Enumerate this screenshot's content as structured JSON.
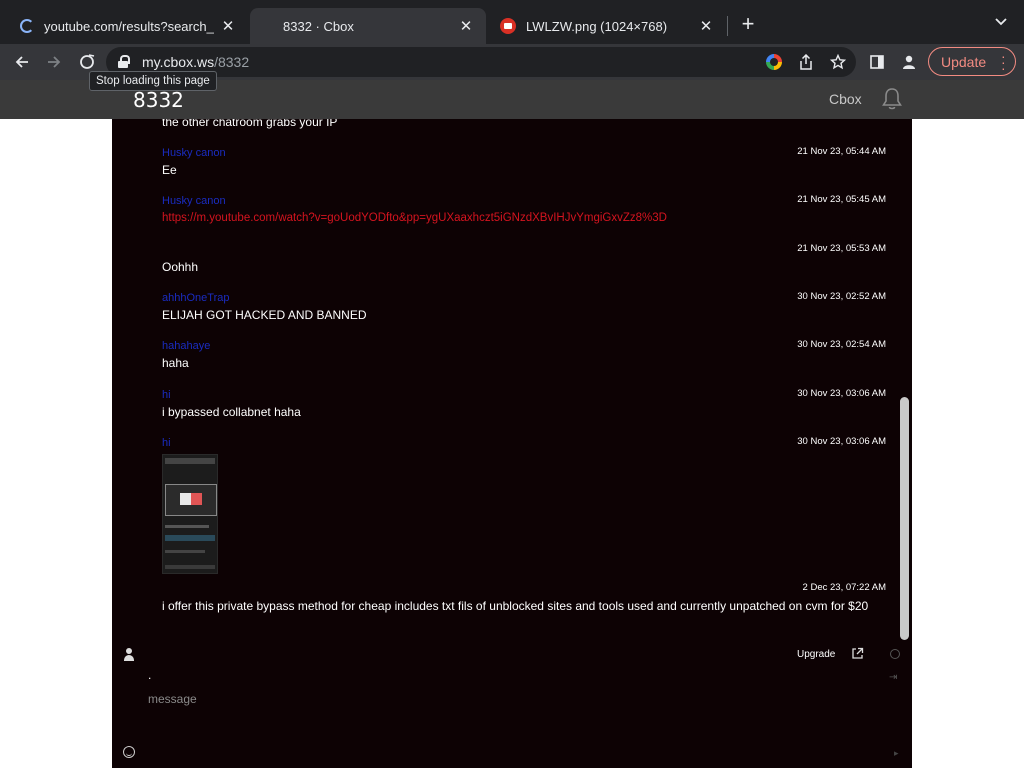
{
  "tabs": [
    {
      "title": "youtube.com/results?search_q",
      "state": "loading"
    },
    {
      "title": "8332 · Cbox",
      "state": "active"
    },
    {
      "title": "LWLZW.png (1024×768)",
      "state": "inactive"
    }
  ],
  "address_bar": {
    "host": "my.cbox.ws",
    "path": "/8332"
  },
  "tooltip": "Stop loading this page",
  "update_label": "Update",
  "site": {
    "title": "8332",
    "nav_link": "Cbox"
  },
  "messages": [
    {
      "name": "",
      "time": "",
      "text": "the other chatroom grabs your IP"
    },
    {
      "name": "Husky canon",
      "time": "21 Nov 23, 05:44 AM",
      "text": "Ee"
    },
    {
      "name": "Husky canon",
      "time": "21 Nov 23, 05:45 AM",
      "link": "https://m.youtube.com/watch?v=goUodYODfto&pp=ygUXaaxhczt5iGNzdXBvIHJvYmgiGxvZz8%3D"
    },
    {
      "name": "",
      "time": "21 Nov 23, 05:53 AM",
      "text": "Oohhh"
    },
    {
      "name": "ahhhOneTrap",
      "time": "30 Nov 23, 02:52 AM",
      "text": "ELIJAH GOT HACKED AND BANNED"
    },
    {
      "name": "hahahaye",
      "time": "30 Nov 23, 02:54 AM",
      "text": "haha"
    },
    {
      "name": "hi",
      "time": "30 Nov 23, 03:06 AM",
      "text": "i bypassed collabnet haha"
    },
    {
      "name": "hi",
      "time": "30 Nov 23, 03:06 AM",
      "image": "screenshot-thumbnail"
    },
    {
      "name": "",
      "time": "2 Dec 23, 07:22 AM",
      "text": "i offer this private bypass method for cheap includes txt fils of unblocked sites and tools used and currently unpatched on cvm for $20"
    }
  ],
  "composer": {
    "upgrade_label": "Upgrade",
    "name_value": ".",
    "placeholder": "message"
  },
  "colors": {
    "chat_bg": "#0d0204",
    "name_color": "#1a2cc0",
    "link_color": "#d4141f",
    "header_bg": "#3a3a3a",
    "update_accent": "#f28b82"
  },
  "icons": [
    "back-icon",
    "forward-icon",
    "stop-loading-icon",
    "lock-icon",
    "google-icon",
    "share-icon",
    "star-icon",
    "sidebar-icon",
    "profile-icon",
    "bell-icon",
    "user-icon",
    "external-link-icon",
    "smile-icon"
  ]
}
